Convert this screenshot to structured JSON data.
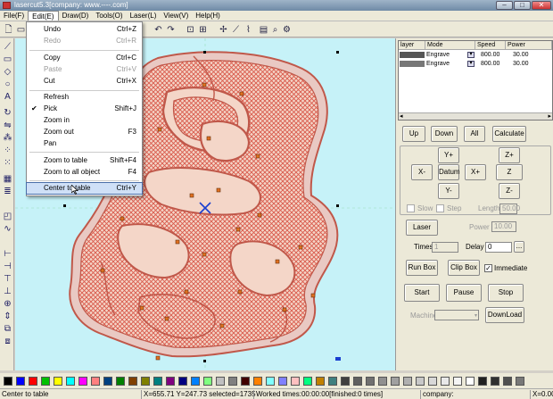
{
  "window": {
    "title": "lasercut5.3[company: www.----.com]",
    "min": "–",
    "max": "□",
    "close": "✕"
  },
  "menubar": [
    "File(F)",
    "Edit(E)",
    "Draw(D)",
    "Tools(O)",
    "Laser(L)",
    "View(V)",
    "Help(H)"
  ],
  "edit_menu": [
    {
      "label": "Undo",
      "shortcut": "Ctrl+Z",
      "disabled": false
    },
    {
      "label": "Redo",
      "shortcut": "Ctrl+R",
      "disabled": true
    },
    {
      "label": "Copy",
      "shortcut": "Ctrl+C",
      "disabled": false
    },
    {
      "label": "Paste",
      "shortcut": "Ctrl+V",
      "disabled": true
    },
    {
      "label": "Cut",
      "shortcut": "Ctrl+X",
      "disabled": false
    },
    {
      "label": "Refresh",
      "shortcut": "",
      "disabled": false
    },
    {
      "label": "Pick",
      "shortcut": "Shift+J",
      "disabled": false,
      "checked": true
    },
    {
      "label": "Zoom in",
      "shortcut": "",
      "disabled": false
    },
    {
      "label": "Zoom out",
      "shortcut": "F3",
      "disabled": false
    },
    {
      "label": "Pan",
      "shortcut": "",
      "disabled": false
    },
    {
      "label": "Zoom to table",
      "shortcut": "Shift+F4",
      "disabled": false
    },
    {
      "label": "Zoom to all object",
      "shortcut": "F4",
      "disabled": false
    },
    {
      "label": "Center to table",
      "shortcut": "Ctrl+Y",
      "disabled": false,
      "highlighted": true
    }
  ],
  "layers": {
    "headers": [
      "layer",
      "Mode",
      "Speed",
      "Power"
    ],
    "rows": [
      {
        "color": "#555555",
        "mode": "Engrave",
        "speed": "800.00",
        "power": "30.00"
      },
      {
        "color": "#777777",
        "mode": "Engrave",
        "speed": "800.00",
        "power": "30.00"
      }
    ]
  },
  "buttons": {
    "up": "Up",
    "down": "Down",
    "all": "All",
    "calculate": "Calculate",
    "y_plus": "Y+",
    "z_plus": "Z+",
    "x_minus": "X-",
    "datum": "Datum",
    "x_plus": "X+",
    "z_datum": "Z Datum",
    "y_minus": "Y-",
    "z_minus": "Z-",
    "laser": "Laser",
    "run_box": "Run Box",
    "clip_box": "Clip Box",
    "start": "Start",
    "pause": "Pause",
    "stop": "Stop",
    "download": "DownLoad",
    "browse": "..."
  },
  "options": {
    "slow": "Slow",
    "step": "Step",
    "length_label": "Length",
    "length_value": "50.00",
    "power_label": "Power",
    "power_value": "10.00",
    "times_label": "Times",
    "times_value": "1",
    "delay_label": "Delay",
    "delay_value": "0",
    "immediate": "Immediate",
    "immediate_checked": "✓",
    "machine_label": "Machine"
  },
  "palette": [
    "#000000",
    "#0000ff",
    "#ff0000",
    "#00c000",
    "#ffff00",
    "#00ffff",
    "#ff00ff",
    "#ff8080",
    "#004080",
    "#008000",
    "#804000",
    "#808000",
    "#008080",
    "#800080",
    "#000080",
    "#0080ff",
    "#80ff80",
    "#c0c0c0",
    "#808080",
    "#400000",
    "#ff8000",
    "#80ffff",
    "#8080ff",
    "#ffc0c0",
    "#00ff80",
    "#c08000",
    "#408080",
    "#404040",
    "#606060",
    "#707070",
    "#909090",
    "#a0a0a0",
    "#b0b0b0",
    "#c8c8c8",
    "#d8d8d8",
    "#e8e8e8",
    "#f4f4f4",
    "#ffffff",
    "#202020",
    "#303030",
    "#505050",
    "#787878"
  ],
  "status": {
    "hint": "Center to table",
    "coords": "X=655.71 Y=247.73 selected=1735",
    "worked": "Worked times:00:00:00[finished:0 times]",
    "company": "company:",
    "right": "X=0.00"
  }
}
